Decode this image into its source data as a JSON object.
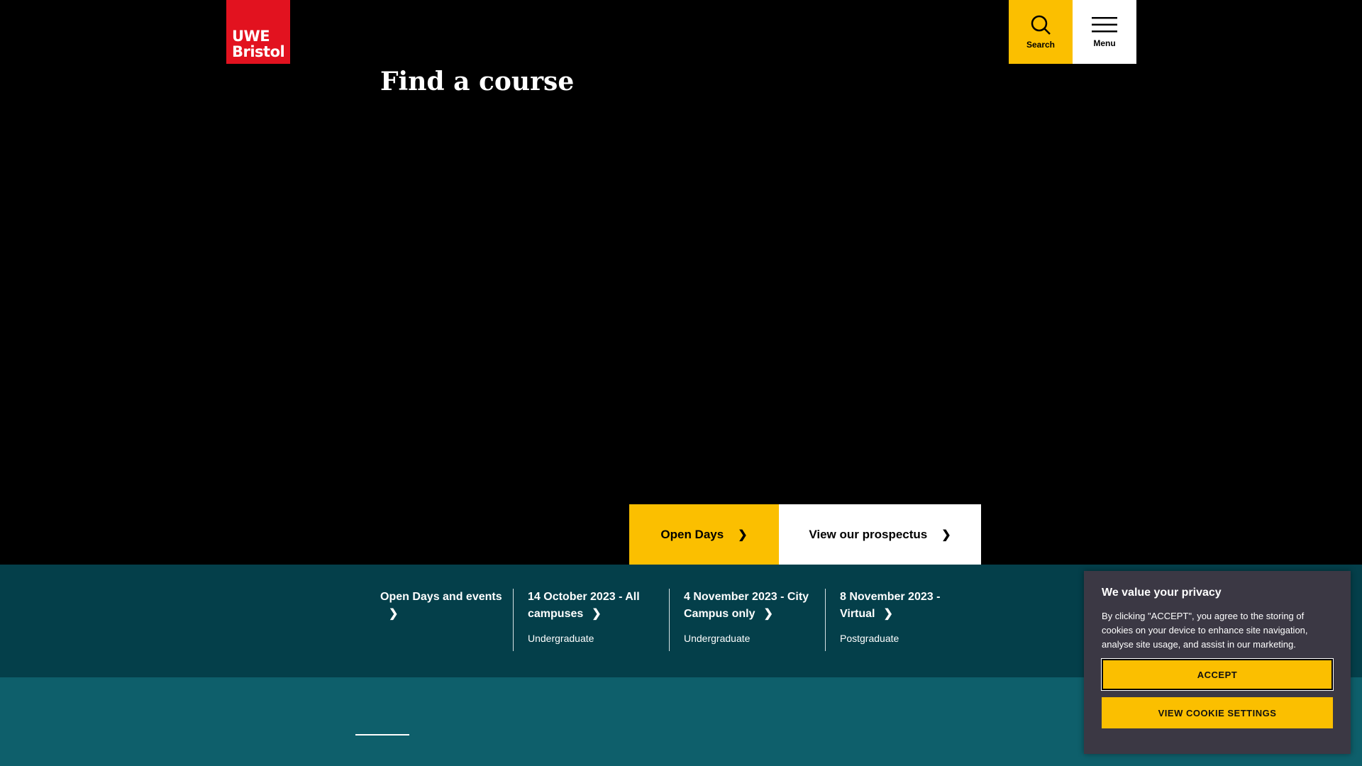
{
  "header": {
    "logo_line1": "UWE",
    "logo_line2": "Bristol",
    "search_label": "Search",
    "menu_label": "Menu"
  },
  "hero": {
    "open_days_label": "Open Days",
    "prospectus_label": "View our prospectus"
  },
  "events": {
    "heading": "Open Days and events",
    "items": [
      {
        "title": "14 October 2023 - All campuses",
        "subtitle": "Undergraduate"
      },
      {
        "title": "4 November 2023 - City Campus only",
        "subtitle": "Undergraduate"
      },
      {
        "title": "8 November 2023 - Virtual",
        "subtitle": "Postgraduate"
      }
    ]
  },
  "find_course": {
    "title": "Find a course"
  },
  "cookie": {
    "title": "We value your privacy",
    "text": "By clicking \"ACCEPT\", you agree to the storing of cookies on your device to enhance site navigation, analyse site usage, and assist in our marketing.",
    "accept_label": "ACCEPT",
    "settings_label": "VIEW COOKIE SETTINGS"
  },
  "colors": {
    "brand_red": "#e2121f",
    "accent_yellow": "#fbbf00",
    "events_bg": "#043f4a",
    "find_bg": "#0e5f6b",
    "cookie_bg": "#3b3844"
  }
}
